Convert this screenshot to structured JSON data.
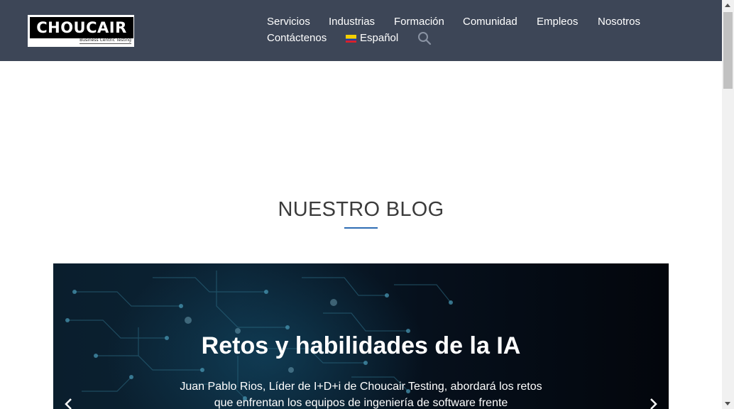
{
  "header": {
    "logo_text": "CHOUCAIR",
    "logo_tagline": "Business Centric Testing",
    "nav": [
      {
        "label": "Servicios"
      },
      {
        "label": "Industrias"
      },
      {
        "label": "Formación"
      },
      {
        "label": "Comunidad"
      },
      {
        "label": "Empleos"
      },
      {
        "label": "Nosotros"
      },
      {
        "label": "Contáctenos"
      },
      {
        "label": "Español"
      }
    ],
    "search_icon": "search-icon",
    "flag_icon": "colombia-flag-icon",
    "colors": {
      "background": "#3d4657",
      "text": "#ffffff"
    }
  },
  "blog": {
    "title": "NUESTRO BLOG",
    "accent_color": "#2e6db4"
  },
  "slider": {
    "title": "Retos y habilidades de la IA",
    "text": "Juan Pablo Rios, Líder de I+D+i de Choucair Testing, abordará los retos que enfrentan los equipos de ingeniería de software frente",
    "prev_icon": "chevron-left-icon",
    "next_icon": "chevron-right-icon"
  }
}
